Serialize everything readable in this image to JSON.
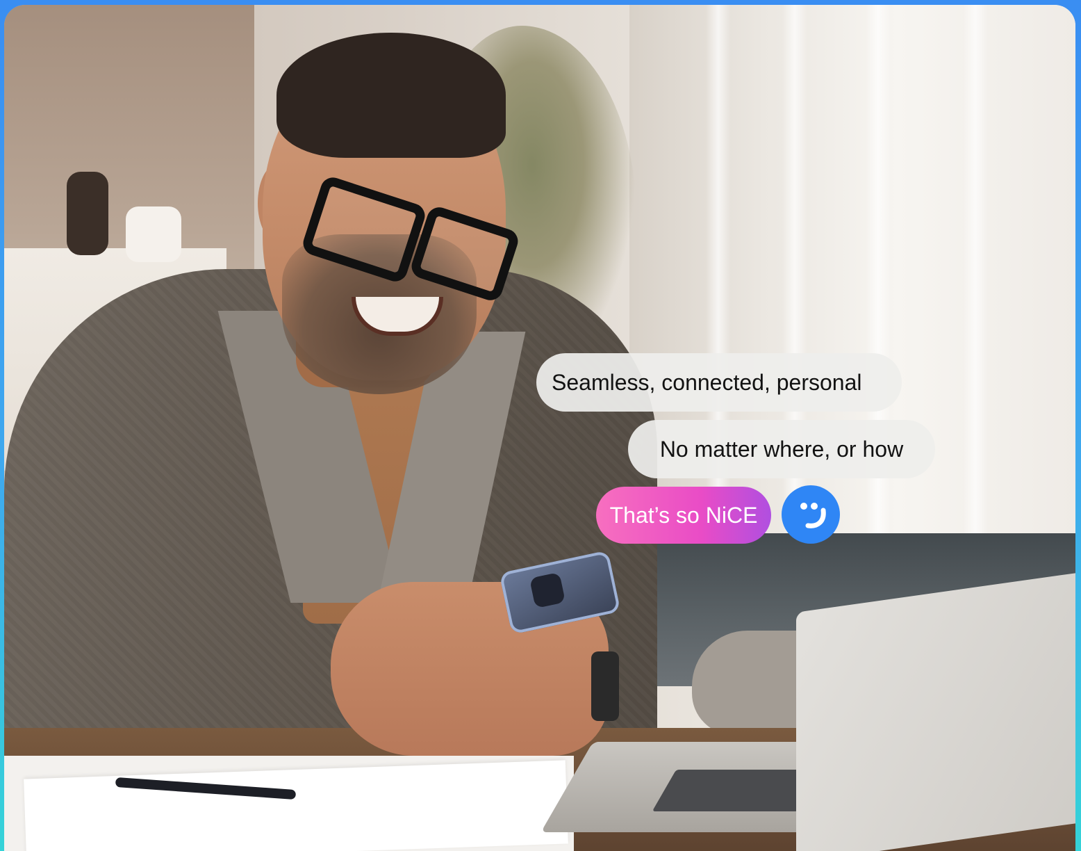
{
  "chat": {
    "bubble_1": "Seamless, connected, personal",
    "bubble_2": "No matter where, or how",
    "bubble_3": "That’s so NiCE"
  },
  "icons": {
    "smiley": "wink-smiley-icon"
  },
  "colors": {
    "frame_top": "#3a8ef2",
    "frame_bottom": "#35d3d8",
    "bubble_grey": "#eeeeec",
    "bubble_pink_start": "#f76fbf",
    "bubble_pink_end": "#b04fe0",
    "smiley_blue": "#2f86f5"
  }
}
